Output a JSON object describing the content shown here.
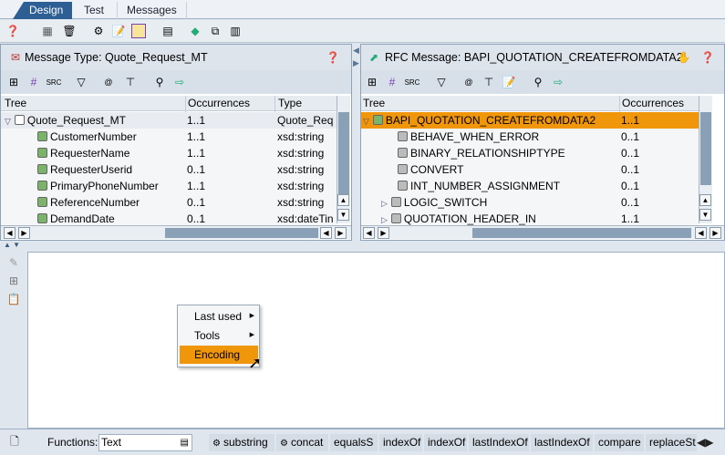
{
  "tabs": [
    "Design",
    "Test",
    "Messages"
  ],
  "left": {
    "title": "Message Type: Quote_Request_MT",
    "columns": [
      "Tree",
      "Occurrences",
      "Type"
    ],
    "rows": [
      {
        "name": "Quote_Request_MT",
        "occ": "1..1",
        "type": "Quote_Req",
        "root": true
      },
      {
        "name": "CustomerNumber",
        "occ": "1..1",
        "type": "xsd:string"
      },
      {
        "name": "RequesterName",
        "occ": "1..1",
        "type": "xsd:string"
      },
      {
        "name": "RequesterUserid",
        "occ": "0..1",
        "type": "xsd:string"
      },
      {
        "name": "PrimaryPhoneNumber",
        "occ": "1..1",
        "type": "xsd:string"
      },
      {
        "name": "ReferenceNumber",
        "occ": "0..1",
        "type": "xsd:string"
      },
      {
        "name": "DemandDate",
        "occ": "0..1",
        "type": "xsd:dateTin"
      }
    ]
  },
  "right": {
    "title": "RFC Message: BAPI_QUOTATION_CREATEFROMDATA2",
    "columns": [
      "Tree",
      "Occurrences"
    ],
    "rows": [
      {
        "name": "BAPI_QUOTATION_CREATEFROMDATA2",
        "occ": "1..1",
        "root": true
      },
      {
        "name": "BEHAVE_WHEN_ERROR",
        "occ": "0..1"
      },
      {
        "name": "BINARY_RELATIONSHIPTYPE",
        "occ": "0..1"
      },
      {
        "name": "CONVERT",
        "occ": "0..1"
      },
      {
        "name": "INT_NUMBER_ASSIGNMENT",
        "occ": "0..1"
      },
      {
        "name": "LOGIC_SWITCH",
        "occ": "0..1",
        "expand": true
      },
      {
        "name": "QUOTATION_HEADER_IN",
        "occ": "1..1",
        "expand": true
      }
    ]
  },
  "context_menu": {
    "items": [
      "Last used",
      "Tools",
      "Encoding"
    ],
    "selected": "Encoding"
  },
  "functions": {
    "label": "Functions:",
    "category": "Text",
    "buttons": [
      "substring",
      "concat",
      "equalsS",
      "indexOf",
      "indexOf",
      "lastIndexOf",
      "lastIndexOf",
      "compare",
      "replaceSt"
    ]
  },
  "colors": {
    "accent": "#f0960a",
    "tab": "#2d5f94"
  }
}
